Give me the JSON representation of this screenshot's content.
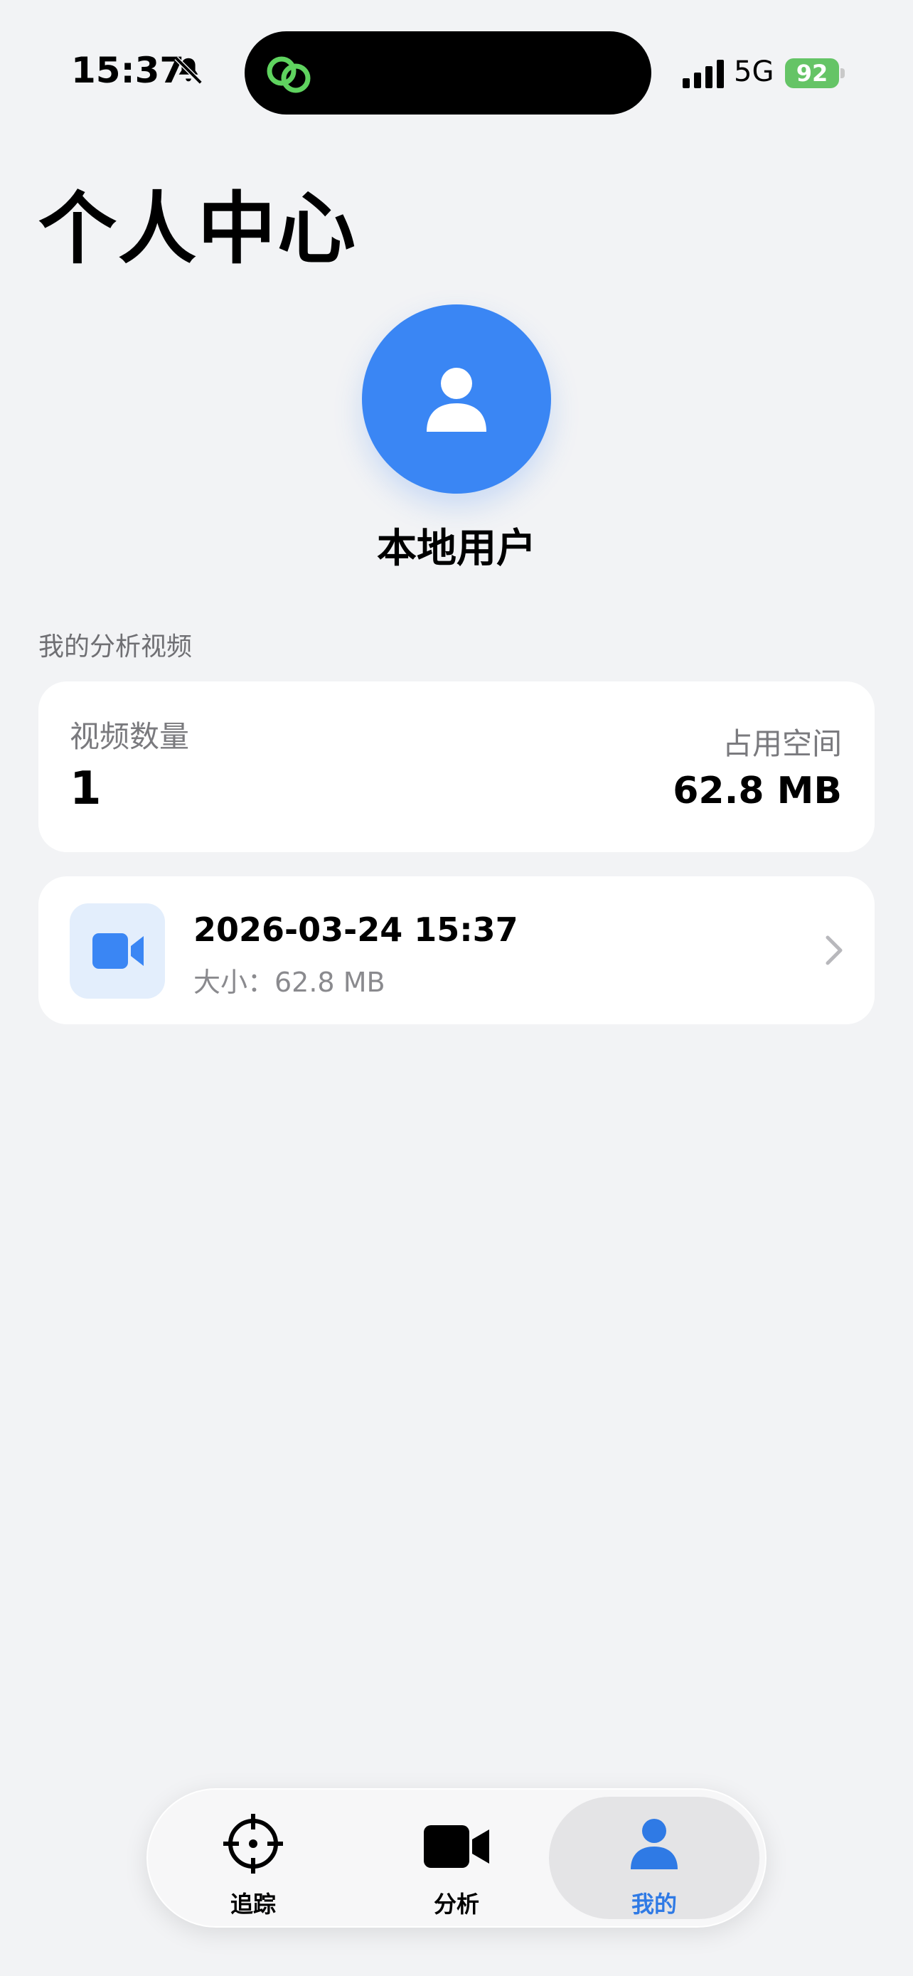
{
  "status_bar": {
    "time": "15:37",
    "network": "5G",
    "battery": "92",
    "icons": [
      "bell-slash-icon",
      "link-icon",
      "signal-icon",
      "battery-charging-icon"
    ]
  },
  "header": {
    "title": "个人中心"
  },
  "profile": {
    "name": "本地用户",
    "avatar_color": "#3a86f4"
  },
  "section": {
    "label": "我的分析视频"
  },
  "stats": {
    "count_label": "视频数量",
    "count_value": "1",
    "space_label": "占用空间",
    "space_value": "62.8 MB"
  },
  "videos": [
    {
      "title": "2026-03-24 15:37",
      "size": "大小：62.8 MB",
      "icon": "video-camera-icon"
    }
  ],
  "tabs": [
    {
      "label": "追踪",
      "icon": "crosshair-icon",
      "active": false
    },
    {
      "label": "分析",
      "icon": "video-camera-icon",
      "active": false
    },
    {
      "label": "我的",
      "icon": "person-icon",
      "active": true
    }
  ],
  "colors": {
    "accent": "#2f7ae5",
    "background": "#f2f3f5",
    "battery": "#65c466"
  }
}
